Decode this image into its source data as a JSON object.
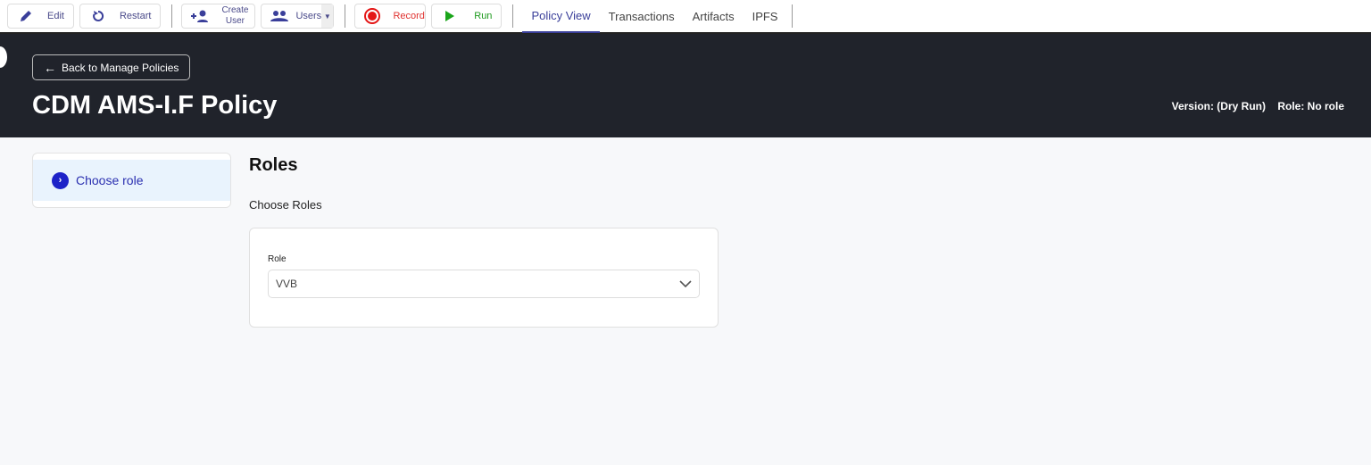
{
  "toolbar": {
    "edit": "Edit",
    "restart": "Restart",
    "create_user": "Create User",
    "users": "Users",
    "record": "Record",
    "run": "Run"
  },
  "tabs": [
    "Policy View",
    "Transactions",
    "Artifacts",
    "IPFS"
  ],
  "header": {
    "back": "Back to Manage Policies",
    "title": "CDM AMS-I.F Policy",
    "version": "Version: (Dry Run)",
    "role": "Role: No role"
  },
  "sidebar": {
    "items": [
      {
        "label": "Choose role"
      }
    ]
  },
  "main": {
    "title": "Roles",
    "subtitle": "Choose Roles",
    "field_label": "Role",
    "field_value": "VVB"
  }
}
